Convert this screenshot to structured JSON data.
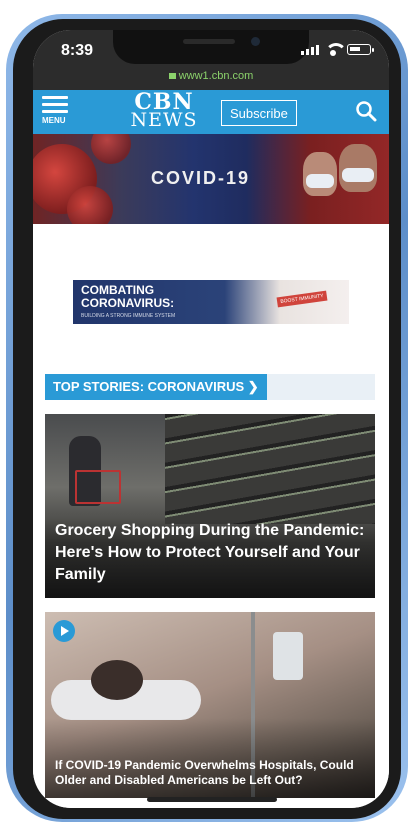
{
  "status_bar": {
    "time": "8:39",
    "url": "www1.cbn.com"
  },
  "header": {
    "menu_label": "MENU",
    "logo_line1": "CBN",
    "logo_line2": "NEWS",
    "subscribe_label": "Subscribe",
    "accent_color": "#2a9ad6"
  },
  "hero": {
    "title": "COVID-19"
  },
  "ad": {
    "line1": "COMBATING",
    "line2": "CORONAVIRUS:",
    "line3": "BUILDING A STRONG IMMUNE SYSTEM",
    "ribbon": "BOOST IMMUNITY"
  },
  "section": {
    "label": "TOP STORIES: CORONAVIRUS ❯"
  },
  "stories": [
    {
      "title": "Grocery Shopping During the Pandemic: Here's How to Protect Yourself and Your Family",
      "has_video": false
    },
    {
      "title": "If COVID-19 Pandemic Overwhelms Hospitals, Could Older and Disabled Americans be Left Out?",
      "has_video": true
    }
  ],
  "icons": {
    "search": "search-icon",
    "menu": "hamburger-icon",
    "play": "play-icon"
  }
}
